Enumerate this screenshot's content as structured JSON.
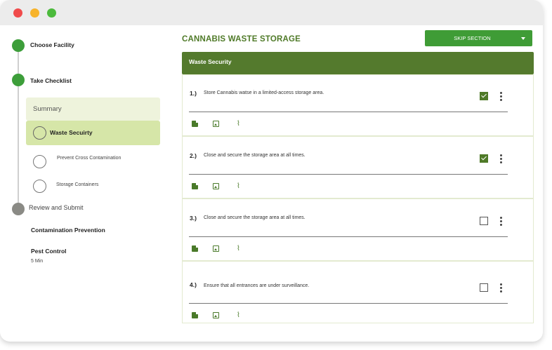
{
  "window": {
    "controls": [
      "close",
      "minimize",
      "maximize"
    ]
  },
  "sidebar": {
    "steps": [
      {
        "label": "Choose Facility",
        "status": "complete"
      },
      {
        "label": "Take Checklist",
        "status": "complete"
      },
      {
        "label": "Review and Submit",
        "status": "pending"
      }
    ],
    "summary_label": "Summary",
    "sub_items": [
      {
        "label": "Waste Secuirty",
        "active": true
      },
      {
        "label": "Prevent Cross Contamination",
        "active": false
      },
      {
        "label": "Storage Containers",
        "active": false
      }
    ],
    "extra_items": [
      {
        "label": "Contamination Prevention"
      },
      {
        "label": "Pest Control",
        "meta": "5 Min"
      }
    ]
  },
  "main": {
    "title": "CANNABIS WASTE STORAGE",
    "skip_button": "SKIP SECTION",
    "section_title": "Waste Security",
    "questions": [
      {
        "number": "1.)",
        "text": "Store Cannabis watse in a limited-access storage area.",
        "checked": true
      },
      {
        "number": "2.)",
        "text": "Close and secure the storage area at all times.",
        "checked": true
      },
      {
        "number": "3.)",
        "text": "Close and secure the storage area at all times.",
        "checked": false
      },
      {
        "number": "4.)",
        "text": "Ensure that all entrances are under surveillance.",
        "checked": false
      }
    ],
    "question_icons": [
      "note-icon",
      "image-icon",
      "attachment-icon"
    ]
  },
  "colors": {
    "accent_green": "#3f9c36",
    "header_green": "#547a2d",
    "title_green": "#4f7a28",
    "active_sub_bg": "#d6e6a8",
    "summary_bg": "#eef3dc"
  }
}
